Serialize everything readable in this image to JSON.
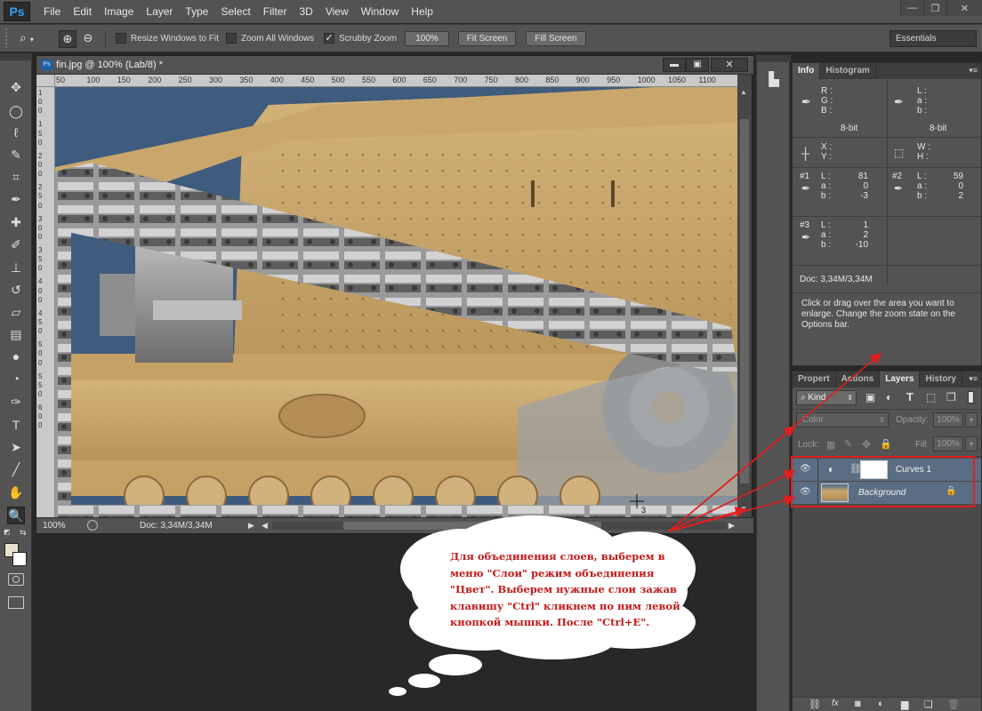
{
  "app": {
    "logo": "Ps",
    "menu": [
      "File",
      "Edit",
      "Image",
      "Layer",
      "Type",
      "Select",
      "Filter",
      "3D",
      "View",
      "Window",
      "Help"
    ],
    "window_controls": [
      "—",
      "❐",
      "✕"
    ]
  },
  "options_bar": {
    "resize_windows_label": "Resize Windows to Fit",
    "resize_windows_checked": false,
    "zoom_all_label": "Zoom All Windows",
    "zoom_all_checked": false,
    "scrubby_label": "Scrubby Zoom",
    "scrubby_checked": true,
    "btn_100": "100%",
    "btn_fit": "Fit Screen",
    "btn_fill": "Fill Screen",
    "workspace": "Essentials"
  },
  "tools": [
    {
      "name": "move-tool",
      "glyph": "✥"
    },
    {
      "name": "marquee-tool",
      "glyph": "◯"
    },
    {
      "name": "lasso-tool",
      "glyph": "ℓ"
    },
    {
      "name": "quick-select-tool",
      "glyph": "✎"
    },
    {
      "name": "crop-tool",
      "glyph": "⌗"
    },
    {
      "name": "eyedropper-tool",
      "glyph": "✒"
    },
    {
      "name": "healing-tool",
      "glyph": "✚"
    },
    {
      "name": "brush-tool",
      "glyph": "✐"
    },
    {
      "name": "stamp-tool",
      "glyph": "⊥"
    },
    {
      "name": "history-brush-tool",
      "glyph": "↺"
    },
    {
      "name": "eraser-tool",
      "glyph": "▱"
    },
    {
      "name": "gradient-tool",
      "glyph": "▤"
    },
    {
      "name": "blur-tool",
      "glyph": "●"
    },
    {
      "name": "dodge-tool",
      "glyph": "◔"
    },
    {
      "name": "pen-tool",
      "glyph": "✑"
    },
    {
      "name": "type-tool",
      "glyph": "T"
    },
    {
      "name": "path-select-tool",
      "glyph": "➤"
    },
    {
      "name": "line-tool",
      "glyph": "╱"
    },
    {
      "name": "hand-tool",
      "glyph": "✋"
    },
    {
      "name": "zoom-tool",
      "glyph": "🔍"
    }
  ],
  "document": {
    "title": "fin.jpg @ 100% (Lab/8) *",
    "ruler_top": [
      "50",
      "100",
      "150",
      "200",
      "250",
      "300",
      "350",
      "400",
      "450",
      "500",
      "550",
      "600",
      "650",
      "700",
      "750",
      "800",
      "850",
      "900",
      "950",
      "1000",
      "1050",
      "1100"
    ],
    "ruler_left": [
      "1",
      "0",
      "0",
      "1",
      "5",
      "0",
      "2",
      "0",
      "0",
      "2",
      "5",
      "0",
      "3",
      "0",
      "0",
      "3",
      "5",
      "0",
      "4",
      "0",
      "0",
      "4",
      "5",
      "0",
      "5",
      "0",
      "0",
      "5",
      "5",
      "0",
      "6",
      "0",
      "0"
    ],
    "zoom": "100%",
    "doc_size": "Doc: 3,34M/3,34M",
    "cursor_label": "3"
  },
  "info_panel": {
    "tabs": [
      "Info",
      "Histogram"
    ],
    "rgb_labels": [
      "R :",
      "G :",
      "B :"
    ],
    "lab_labels": [
      "L :",
      "a :",
      "b :"
    ],
    "bit_left": "8-bit",
    "bit_right": "8-bit",
    "xy_labels": [
      "X :",
      "Y :"
    ],
    "wh_labels": [
      "W :",
      "H :"
    ],
    "s1": {
      "id": "#1",
      "labels": [
        "L :",
        "a :",
        "b :"
      ],
      "values": [
        "81",
        "0",
        "-3"
      ]
    },
    "s2": {
      "id": "#2",
      "labels": [
        "L :",
        "a :",
        "b :"
      ],
      "values": [
        "59",
        "0",
        "2"
      ]
    },
    "s3": {
      "id": "#3",
      "labels": [
        "L :",
        "a :",
        "b :"
      ],
      "values": [
        "1",
        "2",
        "-10"
      ]
    },
    "doc": "Doc: 3,34M/3,34M",
    "hint": "Click or drag over the area you want to enlarge. Change the zoom state on the Options bar."
  },
  "layers_panel": {
    "tabs": [
      "Propert",
      "Actions",
      "Layers",
      "History"
    ],
    "active_tab": "Layers",
    "filter_kind": "Kind",
    "blend_mode": "Color",
    "opacity_label": "Opacity:",
    "opacity_value": "100%",
    "lock_label": "Lock:",
    "fill_label": "Fill:",
    "fill_value": "100%",
    "layers": [
      {
        "name": "Curves 1",
        "type": "adjustment"
      },
      {
        "name": "Background",
        "type": "image"
      }
    ]
  },
  "callout": {
    "text": "Для объединения слоев, выберем в меню \"Слои\" режим объединения \"Цвет\". Выберем нужные слои зажав клавишу \"Ctrl\" кликнем по ним левой кнопкой мышки. После \"Ctrl+E\"."
  },
  "colors": {
    "annotation": "#e01e1e",
    "panel_bg": "#535353",
    "workspace_bg": "#282828",
    "selection": "#5a6d83"
  }
}
